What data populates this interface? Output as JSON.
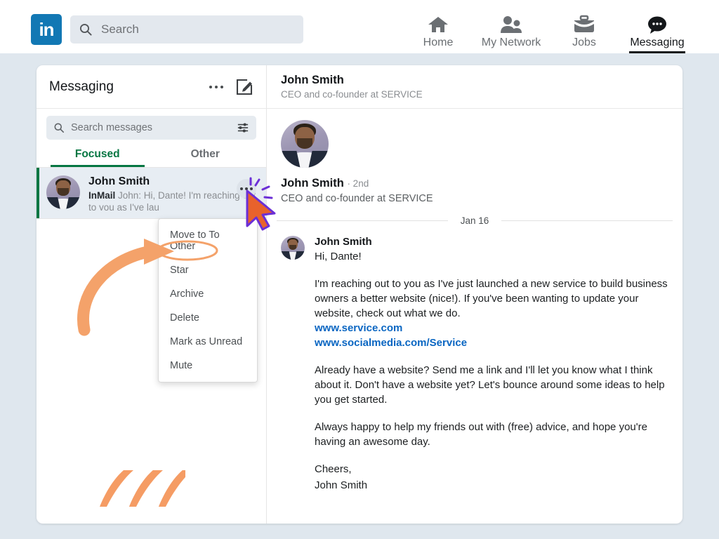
{
  "topnav": {
    "logo_text": "in",
    "search_placeholder": "Search",
    "items": [
      {
        "label": "Home",
        "icon": "home-icon",
        "active": false
      },
      {
        "label": "My Network",
        "icon": "people-icon",
        "active": false
      },
      {
        "label": "Jobs",
        "icon": "briefcase-icon",
        "active": false
      },
      {
        "label": "Messaging",
        "icon": "message-bubble-icon",
        "active": true
      }
    ]
  },
  "left_pane": {
    "title": "Messaging",
    "overflow_icon": "ellipsis-icon",
    "compose_icon": "compose-pencil-icon",
    "search_placeholder": "Search messages",
    "filter_icon": "sliders-filter-icon",
    "tabs": [
      {
        "label": "Focused",
        "active": true
      },
      {
        "label": "Other",
        "active": false
      }
    ],
    "conversation": {
      "name": "John Smith",
      "badge": "InMail",
      "preview": "John: Hi, Dante! I'm reaching out to you as I've lau",
      "overflow_icon": "ellipsis-icon"
    }
  },
  "context_menu": {
    "items": [
      "Move to To Other",
      "Star",
      "Archive",
      "Delete",
      "Mark as Unread",
      "Mute"
    ],
    "highlighted": "Star"
  },
  "thread_header": {
    "name": "John Smith",
    "headline": "CEO and co-founder at SERVICE"
  },
  "profile": {
    "name": "John Smith",
    "degree": "· 2nd",
    "headline": "CEO and co-founder at SERVICE"
  },
  "thread": {
    "date_divider": "Jan 16",
    "message": {
      "sender": "John Smith",
      "greeting": "Hi, Dante!",
      "paragraph_1": "I'm reaching out to you as I've just launched a new service to build business owners a better website (nice!). If you've been wanting to update your website, check out what we do.",
      "links": [
        "www.service.com",
        "www.socialmedia.com/Service"
      ],
      "paragraph_2": "Already have a website? Send me a link and I'll let you know what I think about it. Don't have a website yet? Let's bounce around some ideas to help you get started.",
      "paragraph_3": "Always happy to help my friends out with (free) advice, and hope you're having an awesome day.",
      "signoff": "Cheers,",
      "signature": "John Smith"
    }
  },
  "colors": {
    "brand_blue": "#1278b4",
    "link_blue": "#0a66c2",
    "focused_green": "#057642",
    "annotation_orange": "#f4a26a",
    "cursor_orange": "#e8622c",
    "cursor_outline": "#6b2fd6",
    "page_background": "#dfe7ee"
  }
}
